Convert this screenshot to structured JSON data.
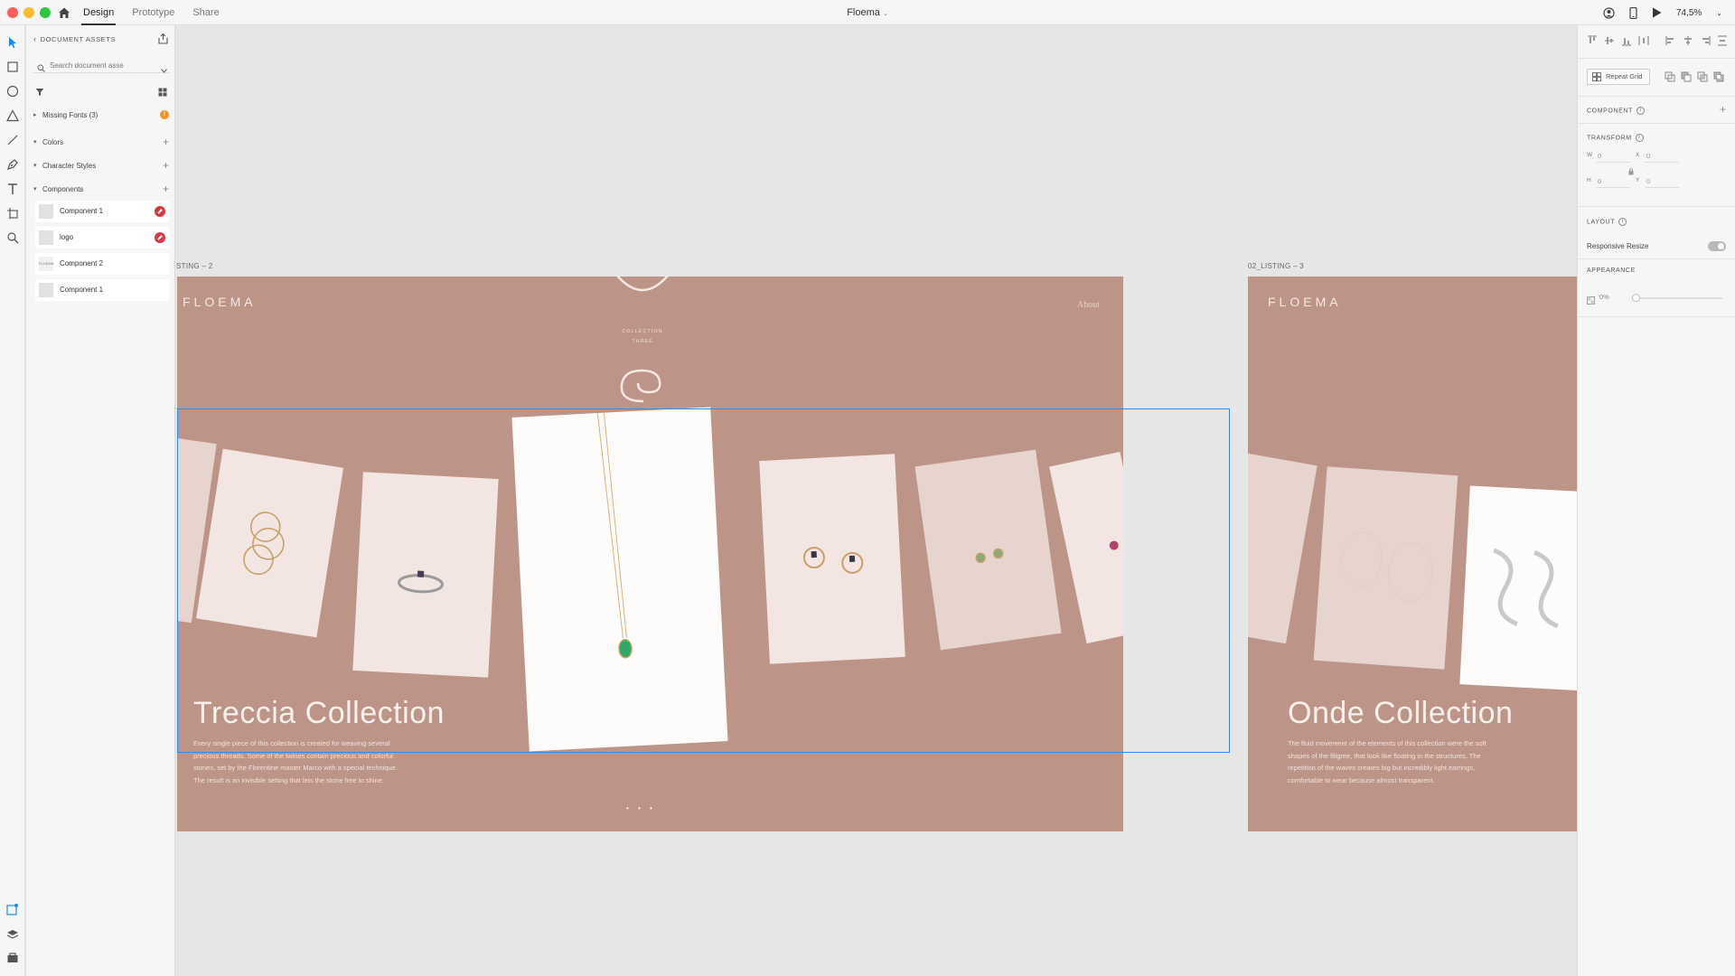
{
  "app": {
    "tabs": [
      {
        "label": "Design",
        "active": true
      },
      {
        "label": "Prototype",
        "active": false
      },
      {
        "label": "Share",
        "active": false
      }
    ],
    "document_title": "Floema",
    "zoom": "74,5%"
  },
  "assets": {
    "header": "DOCUMENT ASSETS",
    "search_placeholder": "Search document asse",
    "sections": {
      "missing_fonts": "Missing Fonts (3)",
      "missing_fonts_badge": "!",
      "colors": "Colors",
      "character_styles": "Character Styles",
      "components": "Components"
    },
    "components": [
      {
        "name": "Component 1",
        "broken": true
      },
      {
        "name": "logo",
        "broken": true
      },
      {
        "name": "Component 2",
        "broken": false,
        "thumb_text": "FLOEMA"
      },
      {
        "name": "Component 1",
        "broken": false
      }
    ]
  },
  "canvas": {
    "artboard_left": {
      "label": "STING – 2",
      "logo": "FLOEMA",
      "about": "About",
      "collection_line1": "COLLECTION",
      "collection_line2": "THREE",
      "heading": "Treccia Collection",
      "description": [
        "Every single piece of this collection is created for weaving several",
        "precious threads. Some of the twines contain precious and colorful",
        "stones, set by the Florentine master Marco with a special technique.",
        "The result is an invisible setting that lets the stone free to shine."
      ],
      "dots": "• • •"
    },
    "artboard_right": {
      "label": "02_LISTING – 3",
      "logo": "FLOEMA",
      "heading": "Onde Collection",
      "description": [
        "The fluid movement of the elements of this collection were the soft",
        "shapes of the filigree, that look like floating in the structures. The",
        "repetition of the waves creates big but incredibly light earrings,",
        "comfortable to wear because almost transparent."
      ]
    },
    "colors": {
      "artboard_bg": "#bd9488",
      "selection": "#2b8cf0"
    }
  },
  "inspector": {
    "repeat_grid": "Repeat Grid",
    "component_label": "COMPONENT",
    "transform_label": "TRANSFORM",
    "w_key": "W",
    "w_value": "0",
    "x_key": "X",
    "x_value": "0",
    "h_key": "H",
    "h_value": "0",
    "y_key": "Y",
    "y_value": "0",
    "layout_label": "LAYOUT",
    "responsive_resize": "Responsive Resize",
    "appearance_label": "APPEARANCE",
    "opacity": "0%"
  }
}
